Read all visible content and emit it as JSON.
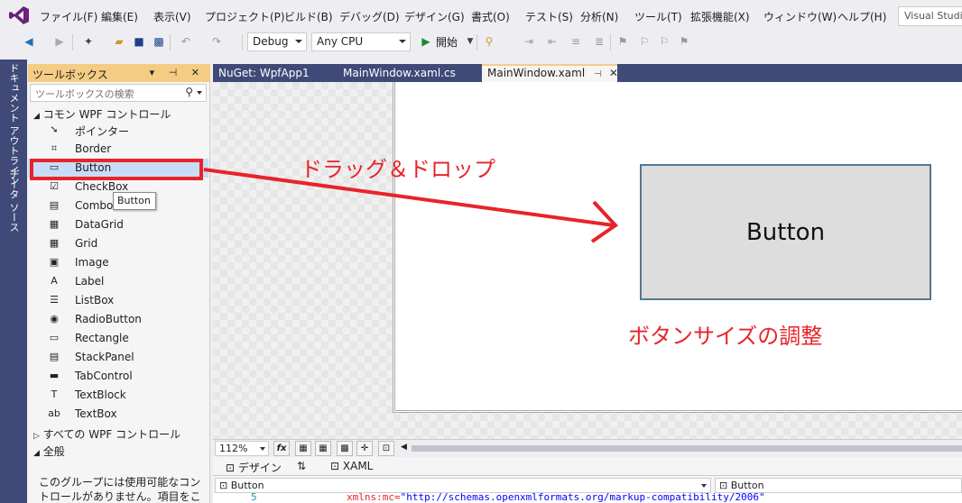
{
  "menubar": {
    "items": [
      "ファイル(F)",
      "編集(E)",
      "表示(V)",
      "プロジェクト(P)",
      "ビルド(B)",
      "デバッグ(D)",
      "デザイン(G)",
      "書式(O)",
      "テスト(S)",
      "分析(N)",
      "ツール(T)",
      "拡張機能(X)",
      "ウィンドウ(W)",
      "ヘルプ(H)"
    ],
    "search_text": "Visual Studio"
  },
  "toolbar": {
    "config": "Debug",
    "platform": "Any CPU",
    "start_label": "開始"
  },
  "sidetabs": [
    "ドキュメント アウトライン",
    "データ ソース"
  ],
  "toolbox": {
    "title": "ツールボックス",
    "search_placeholder": "ツールボックスの検索",
    "section_common": "コモン WPF コントロール",
    "items": [
      {
        "label": "ポインター",
        "icon": "pointer-icon",
        "glyph": "➘"
      },
      {
        "label": "Border",
        "icon": "border-icon",
        "glyph": "⌗"
      },
      {
        "label": "Button",
        "icon": "button-icon",
        "glyph": "▭"
      },
      {
        "label": "CheckBox",
        "icon": "checkbox-icon",
        "glyph": "☑"
      },
      {
        "label": "ComboBox",
        "icon": "combobox-icon",
        "glyph": "▤"
      },
      {
        "label": "DataGrid",
        "icon": "datagrid-icon",
        "glyph": "▦"
      },
      {
        "label": "Grid",
        "icon": "grid-icon",
        "glyph": "▦"
      },
      {
        "label": "Image",
        "icon": "image-icon",
        "glyph": "▣"
      },
      {
        "label": "Label",
        "icon": "label-icon",
        "glyph": "A"
      },
      {
        "label": "ListBox",
        "icon": "listbox-icon",
        "glyph": "☰"
      },
      {
        "label": "RadioButton",
        "icon": "radiobutton-icon",
        "glyph": "◉"
      },
      {
        "label": "Rectangle",
        "icon": "rectangle-icon",
        "glyph": "▭"
      },
      {
        "label": "StackPanel",
        "icon": "stackpanel-icon",
        "glyph": "▤"
      },
      {
        "label": "TabControl",
        "icon": "tabcontrol-icon",
        "glyph": "▬"
      },
      {
        "label": "TextBlock",
        "icon": "textblock-icon",
        "glyph": "T"
      },
      {
        "label": "TextBox",
        "icon": "textbox-icon",
        "glyph": "ab"
      }
    ],
    "selected_index": 2,
    "tooltip": "Button",
    "section_all": "すべての WPF コントロール",
    "section_general": "全般",
    "empty_text": "このグループには使用可能なコントロールがありません。項目をこのテキスト上"
  },
  "doctabs": [
    {
      "label": "NuGet: WpfApp1"
    },
    {
      "label": "MainWindow.xaml.cs"
    },
    {
      "label": "MainWindow.xaml"
    }
  ],
  "designer": {
    "button_content": "Button",
    "annotation_drag": "ドラッグ＆ドロップ",
    "annotation_resize": "ボタンサイズの調整",
    "annotation_color": "#e8232a"
  },
  "zoombar": {
    "zoom": "112%",
    "fx": "fx"
  },
  "viewtabs": {
    "design": "デザイン",
    "swap": "⇅",
    "xaml": "XAML"
  },
  "xamlbar": {
    "left": "Button",
    "right": "Button"
  },
  "code": {
    "line": "5",
    "attr": "xmlns:mc=",
    "value": "\"http://schemas.openxmlformats.org/markup-compatibility/2006\""
  }
}
